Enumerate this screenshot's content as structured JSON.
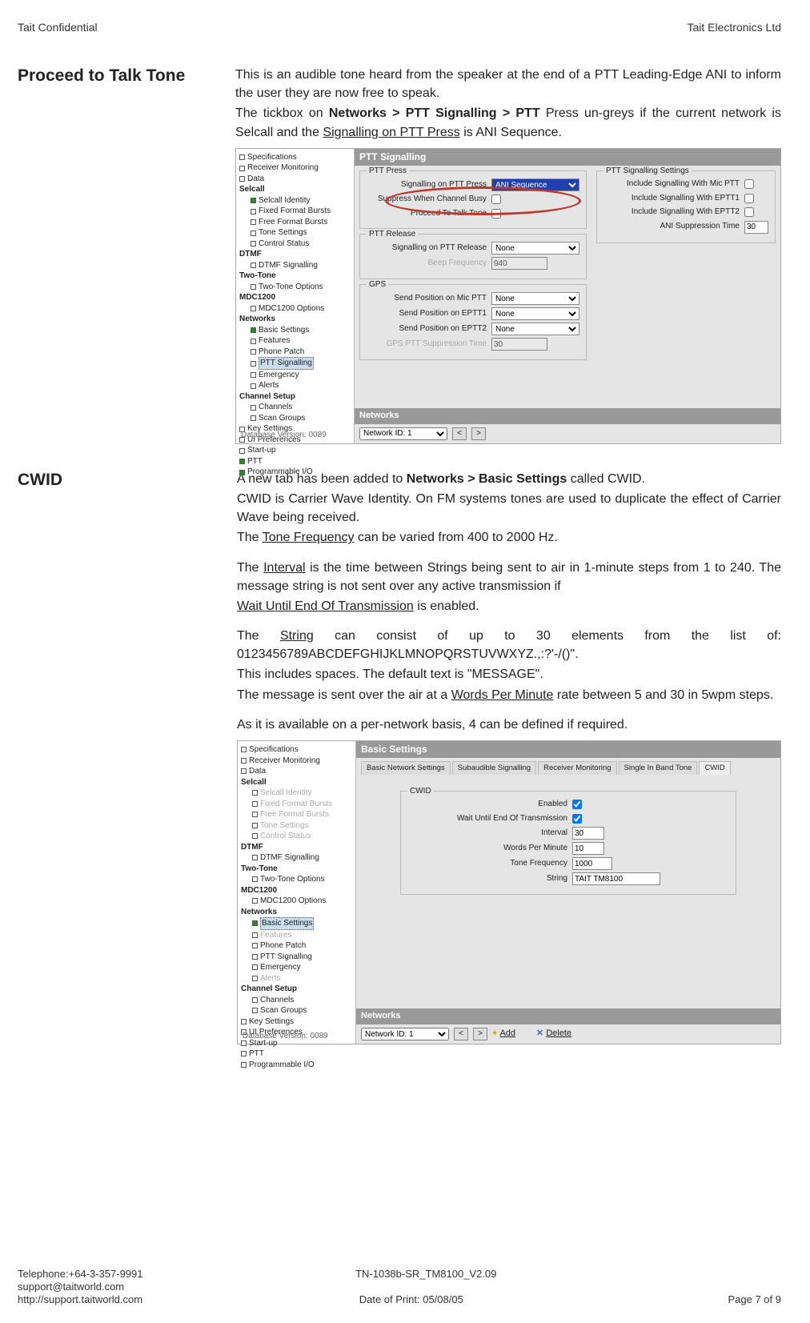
{
  "header": {
    "left": "Tait Confidential",
    "right": "Tait Electronics Ltd"
  },
  "section1": {
    "title": "Proceed to Talk Tone",
    "p1a": "This is an audible tone heard from the speaker at the end of a PTT Leading-Edge ANI to inform the user they are now free to speak.",
    "p2_pre": "The tickbox on ",
    "p2_bold": "Networks > PTT Signalling > PTT",
    "p2_mid": " Press un-greys if the current network is Selcall and the ",
    "p2_u": "Signalling on PTT Press",
    "p2_post": " is ANI Sequence.",
    "shot": {
      "title": "PTT Signalling",
      "tree": [
        {
          "t": "Specifications",
          "sq": "b"
        },
        {
          "t": "Receiver Monitoring",
          "sq": "b"
        },
        {
          "t": "Data",
          "sq": "b"
        },
        {
          "t": "Selcall",
          "sq": "",
          "bold": true
        },
        {
          "t": "Selcall Identity",
          "sq": "g",
          "ind": 1
        },
        {
          "t": "Fixed Format Bursts",
          "sq": "b",
          "ind": 1
        },
        {
          "t": "Free Format Bursts",
          "sq": "b",
          "ind": 1
        },
        {
          "t": "Tone Settings",
          "sq": "b",
          "ind": 1
        },
        {
          "t": "Control Status",
          "sq": "b",
          "ind": 1
        },
        {
          "t": "DTMF",
          "sq": "",
          "bold": true
        },
        {
          "t": "DTMF Signalling",
          "sq": "b",
          "ind": 1
        },
        {
          "t": "Two-Tone",
          "sq": "",
          "bold": true
        },
        {
          "t": "Two-Tone Options",
          "sq": "b",
          "ind": 1
        },
        {
          "t": "MDC1200",
          "sq": "",
          "bold": true
        },
        {
          "t": "MDC1200 Options",
          "sq": "b",
          "ind": 1
        },
        {
          "t": "Networks",
          "sq": "",
          "bold": true
        },
        {
          "t": "Basic Settings",
          "sq": "g",
          "ind": 1
        },
        {
          "t": "Features",
          "sq": "b",
          "ind": 1
        },
        {
          "t": "Phone Patch",
          "sq": "b",
          "ind": 1
        },
        {
          "t": "PTT Signalling",
          "sq": "b",
          "ind": 1,
          "sel": true
        },
        {
          "t": "Emergency",
          "sq": "b",
          "ind": 1
        },
        {
          "t": "Alerts",
          "sq": "b",
          "ind": 1
        },
        {
          "t": "Channel Setup",
          "sq": "",
          "bold": true
        },
        {
          "t": "Channels",
          "sq": "b",
          "ind": 1
        },
        {
          "t": "Scan Groups",
          "sq": "b",
          "ind": 1
        },
        {
          "t": "Key Settings",
          "sq": "b"
        },
        {
          "t": "UI Preferences",
          "sq": "b"
        },
        {
          "t": "Start-up",
          "sq": "b"
        },
        {
          "t": "PTT",
          "sq": "g"
        },
        {
          "t": "Programmable I/O",
          "sq": "g"
        }
      ],
      "ptt_press": {
        "title": "PTT Press",
        "r1": {
          "lbl": "Signalling on PTT Press",
          "val": "ANI Sequence"
        },
        "r2": {
          "lbl": "Suppress When Channel Busy"
        },
        "r3": {
          "lbl": "Proceed To Talk Tone"
        }
      },
      "ptt_release": {
        "title": "PTT Release",
        "r1": {
          "lbl": "Signalling on PTT Release",
          "val": "None"
        },
        "r2": {
          "lbl": "Beep Frequency",
          "val": "940"
        }
      },
      "gps": {
        "title": "GPS",
        "r1": {
          "lbl": "Send Position on Mic PTT",
          "val": "None"
        },
        "r2": {
          "lbl": "Send Position on EPTT1",
          "val": "None"
        },
        "r3": {
          "lbl": "Send Position on EPTT2",
          "val": "None"
        },
        "r4": {
          "lbl": "GPS PTT Suppression Time",
          "val": "30"
        }
      },
      "settings": {
        "title": "PTT Signalling Settings",
        "r1": "Include Signalling With Mic PTT",
        "r2": "Include Signalling With EPTT1",
        "r3": "Include Signalling With EPTT2",
        "r4": {
          "lbl": "ANI Suppression Time",
          "val": "30"
        }
      },
      "networks": {
        "title": "Networks",
        "lbl": "Network ID: 1"
      },
      "dbver": "Database Version: 0089"
    }
  },
  "section2": {
    "title": "CWID",
    "p1_pre": "A new tab has been added to ",
    "p1_bold": "Networks > Basic Settings",
    "p1_post": " called CWID.",
    "p2": "CWID is Carrier Wave Identity. On FM systems tones are used to duplicate the effect of Carrier Wave being received.",
    "p3_pre": "The ",
    "p3_u": "Tone Frequency",
    "p3_post": " can be varied from 400 to 2000 Hz.",
    "p4_pre": "The ",
    "p4_u": "Interval",
    "p4_post": " is the time between Strings being sent to air in 1-minute steps from 1 to 240. The message string is not sent over any active transmission if",
    "p5_u": "Wait Until End Of Transmission",
    "p5_post": " is enabled.",
    "p6_pre": "The ",
    "p6_u": "String",
    "p6_post": " can consist of up to 30 elements from the list of: 0123456789ABCDEFGHIJKLMNOPQRSTUVWXYZ.,:?'-/()\".",
    "p7": "This includes spaces. The default text is \"MESSAGE\".",
    "p8_pre": "The message is sent over the air at a ",
    "p8_u": "Words Per Minute",
    "p8_post": " rate between 5 and 30 in 5wpm steps.",
    "p9": "As it is available on a per-network basis, 4 can be defined if required.",
    "shot": {
      "title": "Basic Settings",
      "tabs": [
        "Basic Network Settings",
        "Subaudible Signalling",
        "Receiver Monitoring",
        "Single In Band Tone",
        "CWID"
      ],
      "tree": [
        {
          "t": "Specifications",
          "sq": "b"
        },
        {
          "t": "Receiver Monitoring",
          "sq": "b"
        },
        {
          "t": "Data",
          "sq": "b"
        },
        {
          "t": "Selcall",
          "sq": "",
          "bold": true
        },
        {
          "t": "Selcall Identity",
          "sq": "b",
          "ind": 1,
          "ghost": true
        },
        {
          "t": "Fixed Format Bursts",
          "sq": "b",
          "ind": 1,
          "ghost": true
        },
        {
          "t": "Free Format Bursts",
          "sq": "b",
          "ind": 1,
          "ghost": true
        },
        {
          "t": "Tone Settings",
          "sq": "b",
          "ind": 1,
          "ghost": true
        },
        {
          "t": "Control Status",
          "sq": "b",
          "ind": 1,
          "ghost": true
        },
        {
          "t": "DTMF",
          "sq": "",
          "bold": true
        },
        {
          "t": "DTMF Signalling",
          "sq": "b",
          "ind": 1
        },
        {
          "t": "Two-Tone",
          "sq": "",
          "bold": true
        },
        {
          "t": "Two-Tone Options",
          "sq": "b",
          "ind": 1
        },
        {
          "t": "MDC1200",
          "sq": "",
          "bold": true
        },
        {
          "t": "MDC1200 Options",
          "sq": "b",
          "ind": 1
        },
        {
          "t": "Networks",
          "sq": "",
          "bold": true
        },
        {
          "t": "Basic Settings",
          "sq": "g",
          "ind": 1,
          "sel": true
        },
        {
          "t": "Features",
          "sq": "b",
          "ind": 1,
          "ghost": true
        },
        {
          "t": "Phone Patch",
          "sq": "b",
          "ind": 1
        },
        {
          "t": "PTT Signalling",
          "sq": "b",
          "ind": 1
        },
        {
          "t": "Emergency",
          "sq": "b",
          "ind": 1
        },
        {
          "t": "Alerts",
          "sq": "b",
          "ind": 1,
          "ghost": true
        },
        {
          "t": "Channel Setup",
          "sq": "",
          "bold": true
        },
        {
          "t": "Channels",
          "sq": "b",
          "ind": 1
        },
        {
          "t": "Scan Groups",
          "sq": "b",
          "ind": 1
        },
        {
          "t": "Key Settings",
          "sq": "b"
        },
        {
          "t": "UI Preferences",
          "sq": "b"
        },
        {
          "t": "Start-up",
          "sq": "b"
        },
        {
          "t": "PTT",
          "sq": "b"
        },
        {
          "t": "Programmable I/O",
          "sq": "b"
        }
      ],
      "cwid": {
        "title": "CWID",
        "r1": {
          "lbl": "Enabled"
        },
        "r2": {
          "lbl": "Wait Until End Of Transmission"
        },
        "r3": {
          "lbl": "Interval",
          "val": "30"
        },
        "r4": {
          "lbl": "Words Per Minute",
          "val": "10"
        },
        "r5": {
          "lbl": "Tone Frequency",
          "val": "1000"
        },
        "r6": {
          "lbl": "String",
          "val": "TAIT TM8100"
        }
      },
      "networks": {
        "title": "Networks",
        "lbl": "Network ID: 1",
        "add": "Add",
        "del": "Delete"
      },
      "dbver": "Database Version: 0089"
    }
  },
  "footer": {
    "tel": "Telephone:+64-3-357-9991",
    "email": "support@taitworld.com",
    "web": "http://support.taitworld.com",
    "doc": "TN-1038b-SR_TM8100_V2.09",
    "date": "Date of Print: 05/08/05",
    "page": "Page 7 of 9"
  }
}
